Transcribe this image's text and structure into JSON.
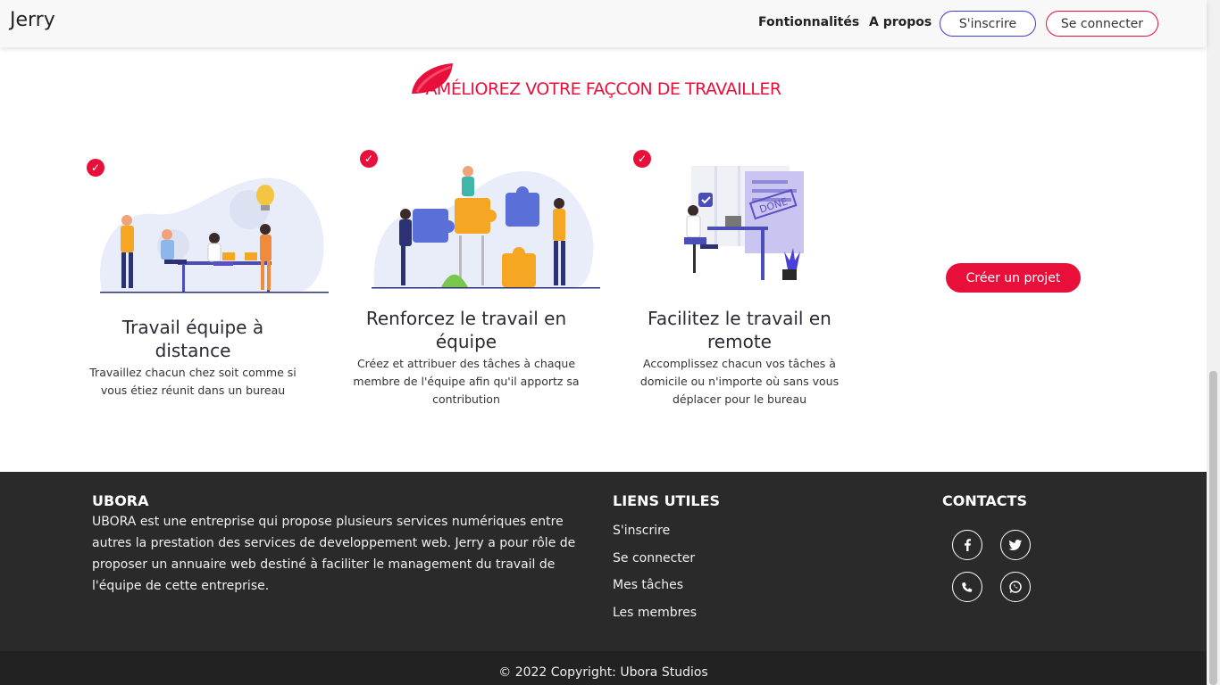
{
  "navbar": {
    "brand": "Jerry",
    "links": [
      "Fontionnalités",
      "A propos"
    ],
    "signup_label": "S'inscrire",
    "login_label": "Se connecter"
  },
  "section": {
    "title": "AMÉLIOREZ VOTRE FAÇCON DE TRAVAILLER"
  },
  "features": [
    {
      "title": "Travail équipe à distance",
      "description": "Travaillez chacun chez soit comme si vous étiez réunit dans un bureau"
    },
    {
      "title": "Renforcez le travail en équipe",
      "description": "Créez et attribuer des tâches à chaque membre de l'équipe afin qu'il apportz sa contribution"
    },
    {
      "title": "Facilitez le travail en remote",
      "description": "Accomplissez chacun vos tâches à domicile ou n'importe où sans vous déplacer pour le bureau"
    }
  ],
  "illustrations": {
    "done_stamp": "DONE"
  },
  "cta_label": "Créer un projet",
  "footer": {
    "about_title": "UBORA",
    "about_text": "UBORA est une entreprise qui propose plusieurs services numériques entre autres la prestation des services de developpement web. Jerry a pour rôle de proposer un annuaire web destiné à faciliter le management du travail de l'équipe de cette entreprise.",
    "links_title": "LIENS UTILES",
    "links": [
      "S'inscrire",
      "Se connecter",
      "Mes tâches",
      "Les membres"
    ],
    "contacts_title": "CONTACTS",
    "social_icons": [
      "facebook-icon",
      "twitter-icon",
      "phone-icon",
      "whatsapp-icon"
    ],
    "copyright": "© 2022 Copyright: Ubora Studios"
  },
  "colors": {
    "accent": "#e8103b",
    "signup_border": "#3f3cdb",
    "footer_bg": "#2a2a2a"
  }
}
